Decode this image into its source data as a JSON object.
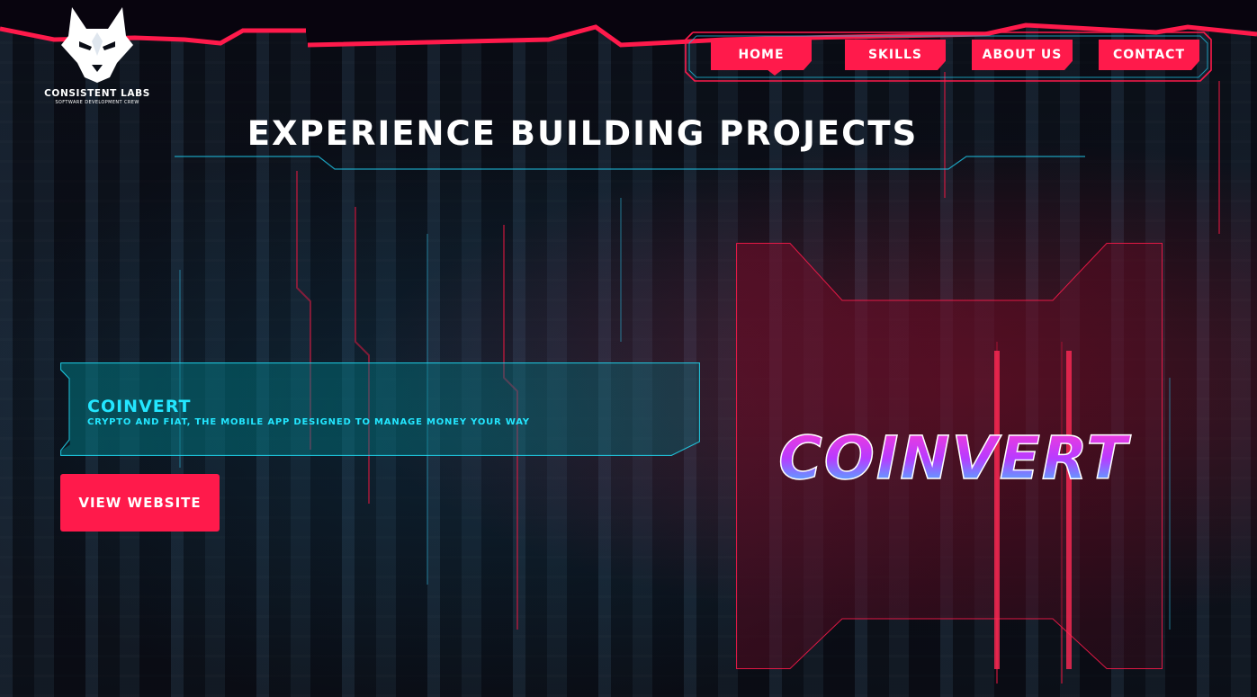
{
  "brand": {
    "name": "CONSISTENT LABS",
    "tagline": "SOFTWARE DEVELOPMENT CREW"
  },
  "nav": {
    "items": [
      {
        "label": "HOME",
        "active": true
      },
      {
        "label": "SKILLS",
        "active": false
      },
      {
        "label": "ABOUT US",
        "active": false
      },
      {
        "label": "CONTACT",
        "active": false
      }
    ]
  },
  "page": {
    "title": "EXPERIENCE BUILDING PROJECTS"
  },
  "project": {
    "name": "COINVERT",
    "description": "CRYPTO AND FIAT, THE MOBILE APP DESIGNED TO MANAGE MONEY YOUR WAY",
    "cta": "VIEW WEBSITE",
    "preview_logo_text": "COINVERT"
  },
  "colors": {
    "accent": "#ff1a4b",
    "cyan": "#23e6ff",
    "background": "#0a0d16"
  },
  "icons": {
    "logo": "wolf-head-icon"
  }
}
